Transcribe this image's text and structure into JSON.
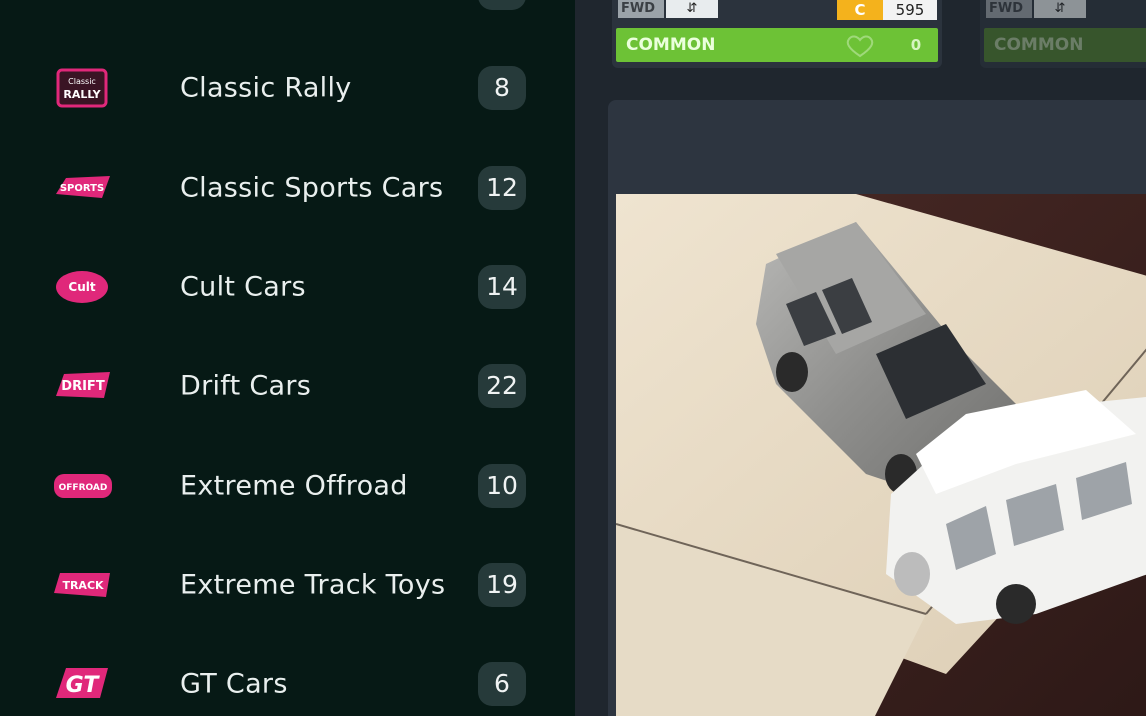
{
  "sidebar": {
    "items": [
      {
        "label": "Classic Rally",
        "count": "8",
        "icon": "classic-rally-logo"
      },
      {
        "label": "Classic Sports Cars",
        "count": "12",
        "icon": "classic-sports-logo"
      },
      {
        "label": "Cult Cars",
        "count": "14",
        "icon": "cult-cars-logo"
      },
      {
        "label": "Drift Cars",
        "count": "22",
        "icon": "drift-logo"
      },
      {
        "label": "Extreme Offroad",
        "count": "10",
        "icon": "offroad-logo"
      },
      {
        "label": "Extreme Track Toys",
        "count": "19",
        "icon": "track-toys-logo"
      },
      {
        "label": "GT Cars",
        "count": "6",
        "icon": "gt-logo"
      }
    ]
  },
  "cards": [
    {
      "drivetrain": "FWD",
      "class_letter": "C",
      "score": "595",
      "rarity": "COMMON",
      "owned": "0"
    },
    {
      "drivetrain": "FWD",
      "rarity": "COMMON"
    }
  ],
  "colors": {
    "sidebar_bg": "#061915",
    "count_badge": "#263a3a",
    "common_green": "#6dc236",
    "class_c_yellow": "#f4b21c",
    "logo_pink": "#e0287a"
  }
}
